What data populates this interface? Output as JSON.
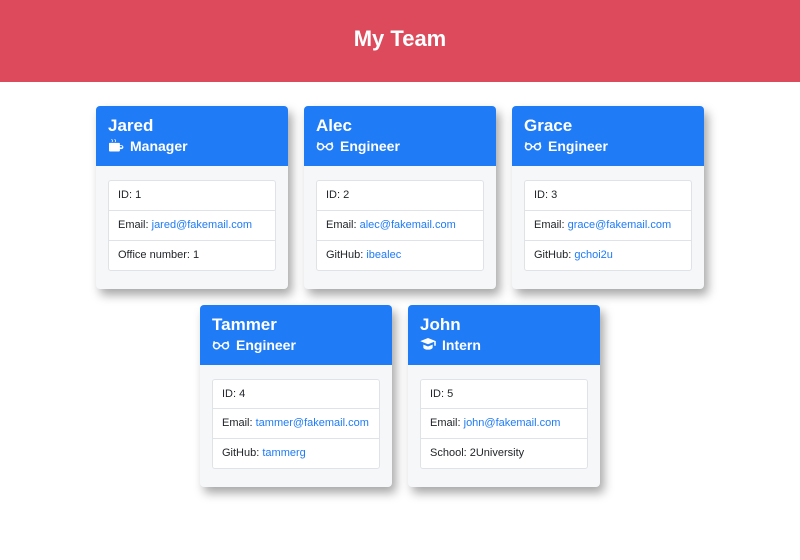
{
  "header": {
    "title": "My Team"
  },
  "labels": {
    "id_prefix": "ID: ",
    "email_prefix": "Email: ",
    "office_prefix": "Office number: ",
    "github_prefix": "GitHub: ",
    "school_prefix": "School: "
  },
  "roles": {
    "manager": "Manager",
    "engineer": "Engineer",
    "intern": "Intern"
  },
  "team": [
    {
      "name": "Jared",
      "role": "manager",
      "id": "1",
      "email": "jared@fakemail.com",
      "extra_key": "office",
      "extra_value": "1"
    },
    {
      "name": "Alec",
      "role": "engineer",
      "id": "2",
      "email": "alec@fakemail.com",
      "extra_key": "github",
      "extra_value": "ibealec"
    },
    {
      "name": "Grace",
      "role": "engineer",
      "id": "3",
      "email": "grace@fakemail.com",
      "extra_key": "github",
      "extra_value": "gchoi2u"
    },
    {
      "name": "Tammer",
      "role": "engineer",
      "id": "4",
      "email": "tammer@fakemail.com",
      "extra_key": "github",
      "extra_value": "tammerg"
    },
    {
      "name": "John",
      "role": "intern",
      "id": "5",
      "email": "john@fakemail.com",
      "extra_key": "school",
      "extra_value": "2University"
    }
  ]
}
